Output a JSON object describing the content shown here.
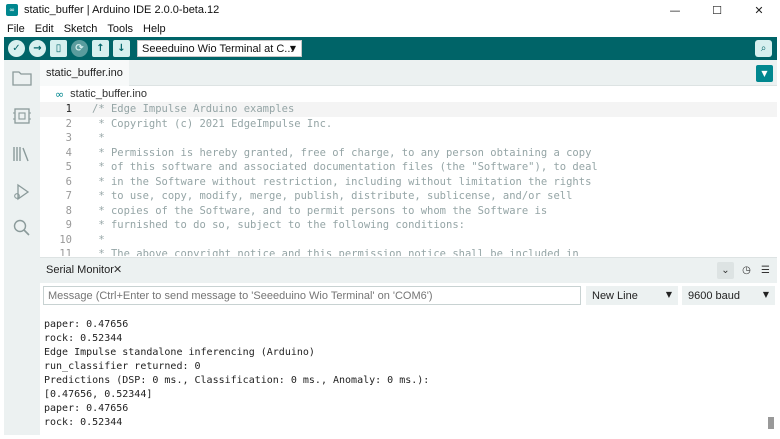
{
  "window": {
    "title": "static_buffer | Arduino IDE 2.0.0-beta.12",
    "app_icon_glyph": "∞",
    "controls": {
      "minimize": "—",
      "maximize": "☐",
      "close": "✕"
    }
  },
  "menu": [
    "File",
    "Edit",
    "Sketch",
    "Tools",
    "Help"
  ],
  "toolbar": {
    "buttons": [
      {
        "name": "verify-button",
        "glyph": "✓"
      },
      {
        "name": "upload-button",
        "glyph": "→"
      },
      {
        "name": "new-sketch-button",
        "glyph": "▯"
      },
      {
        "name": "debug-button",
        "glyph": "⟳"
      },
      {
        "name": "open-button",
        "glyph": "↑"
      },
      {
        "name": "save-button",
        "glyph": "↓"
      }
    ],
    "board": "Seeeduino Wio Terminal at C...",
    "board_caret": "▼",
    "serial_monitor_glyph": "⌕"
  },
  "sidebar_icons": [
    "folder-icon",
    "board-icon",
    "library-icon",
    "debug-icon",
    "search-icon"
  ],
  "editor": {
    "tab": "static_buffer.ino",
    "tab_menu_glyph": "▼",
    "breadcrumb_glyph": "∞",
    "breadcrumb": "static_buffer.ino",
    "lines": [
      {
        "n": "1",
        "text": "/* Edge Impulse Arduino examples"
      },
      {
        "n": "2",
        "text": " * Copyright (c) 2021 EdgeImpulse Inc."
      },
      {
        "n": "3",
        "text": " *"
      },
      {
        "n": "4",
        "text": " * Permission is hereby granted, free of charge, to any person obtaining a copy"
      },
      {
        "n": "5",
        "text": " * of this software and associated documentation files (the \"Software\"), to deal"
      },
      {
        "n": "6",
        "text": " * in the Software without restriction, including without limitation the rights"
      },
      {
        "n": "7",
        "text": " * to use, copy, modify, merge, publish, distribute, sublicense, and/or sell"
      },
      {
        "n": "8",
        "text": " * copies of the Software, and to permit persons to whom the Software is"
      },
      {
        "n": "9",
        "text": " * furnished to do so, subject to the following conditions:"
      },
      {
        "n": "10",
        "text": " *"
      },
      {
        "n": "11",
        "text": " * The above copyright notice and this permission notice shall be included in"
      }
    ]
  },
  "serial_monitor": {
    "title": "Serial Monitor",
    "close_glyph": "✕",
    "controls": {
      "collapse": "⌄",
      "timestamp": "◷",
      "clear": "☰"
    },
    "input_placeholder": "Message (Ctrl+Enter to send message to 'Seeeduino Wio Terminal' on 'COM6')",
    "line_ending": "New Line",
    "baud": "9600 baud",
    "caret": "▼",
    "output": [
      "paper: 0.47656",
      "rock: 0.52344",
      "Edge Impulse standalone inferencing (Arduino)",
      "run_classifier returned: 0",
      "Predictions (DSP: 0 ms., Classification: 0 ms., Anomaly: 0 ms.):",
      "[0.47656, 0.52344]",
      "paper: 0.47656",
      "rock: 0.52344"
    ]
  },
  "colors": {
    "accent": "#006468",
    "accent_light": "#00878f",
    "panel": "#ecf1f1"
  }
}
